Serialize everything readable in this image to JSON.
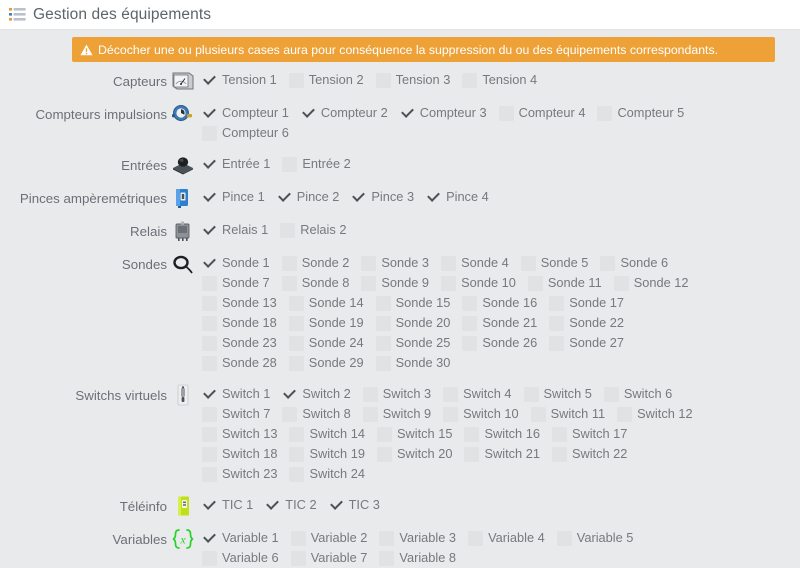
{
  "header": {
    "icon": "ordered-list-icon",
    "title": "Gestion des équipements"
  },
  "banner": {
    "icon": "warning-triangle-icon",
    "text": "Décocher une ou plusieurs cases aura pour conséquence la suppression du ou des équipements correspondants.",
    "background_color": "#eda137",
    "text_color": "#ffffff"
  },
  "colors": {
    "page_background": "#e9eaec",
    "header_background": "#ffffff",
    "label_text": "#6b7076",
    "checkbox_empty": "#e1e2e4",
    "checkmark": "#4c5156"
  },
  "groups": [
    {
      "label": "Capteurs",
      "icon": "analog-meter-icon",
      "items": [
        {
          "label": "Tension 1",
          "checked": true
        },
        {
          "label": "Tension 2",
          "checked": false
        },
        {
          "label": "Tension 3",
          "checked": false
        },
        {
          "label": "Tension 4",
          "checked": false
        }
      ]
    },
    {
      "label": "Compteurs impulsions",
      "icon": "water-meter-icon",
      "items": [
        {
          "label": "Compteur 1",
          "checked": true
        },
        {
          "label": "Compteur 2",
          "checked": true
        },
        {
          "label": "Compteur 3",
          "checked": true
        },
        {
          "label": "Compteur 4",
          "checked": false
        },
        {
          "label": "Compteur 5",
          "checked": false
        },
        {
          "label": "Compteur 6",
          "checked": false
        }
      ]
    },
    {
      "label": "Entrées",
      "icon": "push-button-icon",
      "items": [
        {
          "label": "Entrée 1",
          "checked": true
        },
        {
          "label": "Entrée 2",
          "checked": false
        }
      ]
    },
    {
      "label": "Pinces ampèremétriques",
      "icon": "current-clamp-icon",
      "items": [
        {
          "label": "Pince 1",
          "checked": true
        },
        {
          "label": "Pince 2",
          "checked": true
        },
        {
          "label": "Pince 3",
          "checked": true
        },
        {
          "label": "Pince 4",
          "checked": true
        }
      ]
    },
    {
      "label": "Relais",
      "icon": "relay-icon",
      "items": [
        {
          "label": "Relais 1",
          "checked": true
        },
        {
          "label": "Relais 2",
          "checked": false
        }
      ]
    },
    {
      "label": "Sondes",
      "icon": "probe-sensor-icon",
      "items": [
        {
          "label": "Sonde 1",
          "checked": true
        },
        {
          "label": "Sonde 2",
          "checked": false
        },
        {
          "label": "Sonde 3",
          "checked": false
        },
        {
          "label": "Sonde 4",
          "checked": false
        },
        {
          "label": "Sonde 5",
          "checked": false
        },
        {
          "label": "Sonde 6",
          "checked": false
        },
        {
          "label": "Sonde 7",
          "checked": false
        },
        {
          "label": "Sonde 8",
          "checked": false
        },
        {
          "label": "Sonde 9",
          "checked": false
        },
        {
          "label": "Sonde 10",
          "checked": false
        },
        {
          "label": "Sonde 11",
          "checked": false
        },
        {
          "label": "Sonde 12",
          "checked": false
        },
        {
          "label": "Sonde 13",
          "checked": false
        },
        {
          "label": "Sonde 14",
          "checked": false
        },
        {
          "label": "Sonde 15",
          "checked": false
        },
        {
          "label": "Sonde 16",
          "checked": false
        },
        {
          "label": "Sonde 17",
          "checked": false
        },
        {
          "label": "Sonde 18",
          "checked": false
        },
        {
          "label": "Sonde 19",
          "checked": false
        },
        {
          "label": "Sonde 20",
          "checked": false
        },
        {
          "label": "Sonde 21",
          "checked": false
        },
        {
          "label": "Sonde 22",
          "checked": false
        },
        {
          "label": "Sonde 23",
          "checked": false
        },
        {
          "label": "Sonde 24",
          "checked": false
        },
        {
          "label": "Sonde 25",
          "checked": false
        },
        {
          "label": "Sonde 26",
          "checked": false
        },
        {
          "label": "Sonde 27",
          "checked": false
        },
        {
          "label": "Sonde 28",
          "checked": false
        },
        {
          "label": "Sonde 29",
          "checked": false
        },
        {
          "label": "Sonde 30",
          "checked": false
        }
      ]
    },
    {
      "label": "Switchs virtuels",
      "icon": "light-switch-icon",
      "items": [
        {
          "label": "Switch 1",
          "checked": true
        },
        {
          "label": "Switch 2",
          "checked": true
        },
        {
          "label": "Switch 3",
          "checked": false
        },
        {
          "label": "Switch 4",
          "checked": false
        },
        {
          "label": "Switch 5",
          "checked": false
        },
        {
          "label": "Switch 6",
          "checked": false
        },
        {
          "label": "Switch 7",
          "checked": false
        },
        {
          "label": "Switch 8",
          "checked": false
        },
        {
          "label": "Switch 9",
          "checked": false
        },
        {
          "label": "Switch 10",
          "checked": false
        },
        {
          "label": "Switch 11",
          "checked": false
        },
        {
          "label": "Switch 12",
          "checked": false
        },
        {
          "label": "Switch 13",
          "checked": false
        },
        {
          "label": "Switch 14",
          "checked": false
        },
        {
          "label": "Switch 15",
          "checked": false
        },
        {
          "label": "Switch 16",
          "checked": false
        },
        {
          "label": "Switch 17",
          "checked": false
        },
        {
          "label": "Switch 18",
          "checked": false
        },
        {
          "label": "Switch 19",
          "checked": false
        },
        {
          "label": "Switch 20",
          "checked": false
        },
        {
          "label": "Switch 21",
          "checked": false
        },
        {
          "label": "Switch 22",
          "checked": false
        },
        {
          "label": "Switch 23",
          "checked": false
        },
        {
          "label": "Switch 24",
          "checked": false
        }
      ]
    },
    {
      "label": "Téléinfo",
      "icon": "teleinfo-module-icon",
      "items": [
        {
          "label": "TIC 1",
          "checked": true
        },
        {
          "label": "TIC 2",
          "checked": true
        },
        {
          "label": "TIC 3",
          "checked": true
        }
      ]
    },
    {
      "label": "Variables",
      "icon": "variable-braces-icon",
      "items": [
        {
          "label": "Variable 1",
          "checked": true
        },
        {
          "label": "Variable 2",
          "checked": false
        },
        {
          "label": "Variable 3",
          "checked": false
        },
        {
          "label": "Variable 4",
          "checked": false
        },
        {
          "label": "Variable 5",
          "checked": false
        },
        {
          "label": "Variable 6",
          "checked": false
        },
        {
          "label": "Variable 7",
          "checked": false
        },
        {
          "label": "Variable 8",
          "checked": false
        }
      ]
    }
  ]
}
